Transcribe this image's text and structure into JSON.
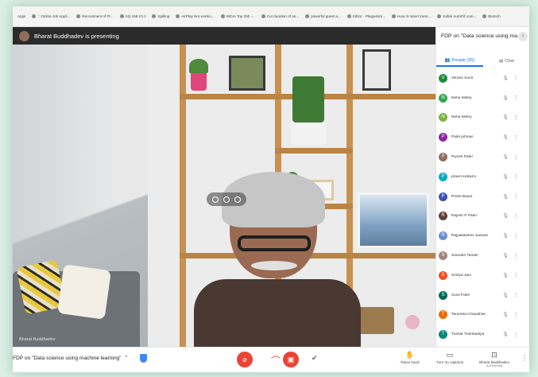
{
  "bookmarks": [
    "Apps",
    ":: Online Job Appli...",
    "Recruitment of Pr...",
    "SQ 168 10.1",
    "Spilling",
    "AirPlay Not workin...",
    "INDIA Top 250 -...",
    "Cut duration of an...",
    "powerful guest a...",
    "Editor - Plagiarism...",
    "How to insert trans...",
    "Safari AutoFill com...",
    "Biotech"
  ],
  "presenting": {
    "text": "Bharat Buddhadev is presenting"
  },
  "video": {
    "speaker_label": "Bharat Buddhadev"
  },
  "side": {
    "title": "FDP on \"Data science using mach...",
    "tabs": {
      "people": "People (26)",
      "chat": "Chat"
    },
    "participants": [
      {
        "name": "Vikram Sunil",
        "initial": "V",
        "color": "#1e8e3e"
      },
      {
        "name": "Neha Mistry",
        "initial": "N",
        "color": "#34a853"
      },
      {
        "name": "Neha Mistry",
        "initial": "N",
        "color": "#7cb342"
      },
      {
        "name": "Patel jahnavi",
        "initial": "P",
        "color": "#8e24aa"
      },
      {
        "name": "Piyush Patel",
        "initial": "P",
        "color": "#8d6e63"
      },
      {
        "name": "pravin kulkarni",
        "initial": "P",
        "color": "#00acc1"
      },
      {
        "name": "Preeti Bayar",
        "initial": "P",
        "color": "#3f51b5"
      },
      {
        "name": "Rajesh P Patel",
        "initial": "R",
        "color": "#5d4037"
      },
      {
        "name": "Rajyalakshmi Jaiswal",
        "initial": "R",
        "color": "#6d8fd1"
      },
      {
        "name": "Saurabh Tandel",
        "initial": "S",
        "color": "#a1887f"
      },
      {
        "name": "Smitya Jain",
        "initial": "S",
        "color": "#f4511e"
      },
      {
        "name": "Sunil Patel",
        "initial": "S",
        "color": "#00695c"
      },
      {
        "name": "Taruneka Chaudhari",
        "initial": "T",
        "color": "#ef6c00"
      },
      {
        "name": "Tushar Trambadiya",
        "initial": "T",
        "color": "#00897b"
      }
    ]
  },
  "bottom": {
    "meeting_title": "FDP on \"Data science using machine learning\"",
    "raise_hand": "Raise hand",
    "captions": "Turn on captions",
    "presenter_name": "Bharat Buddhadev",
    "presenter_sub": "is presenting"
  },
  "colors": {
    "accent": "#1a73e8",
    "danger": "#ea4335"
  }
}
